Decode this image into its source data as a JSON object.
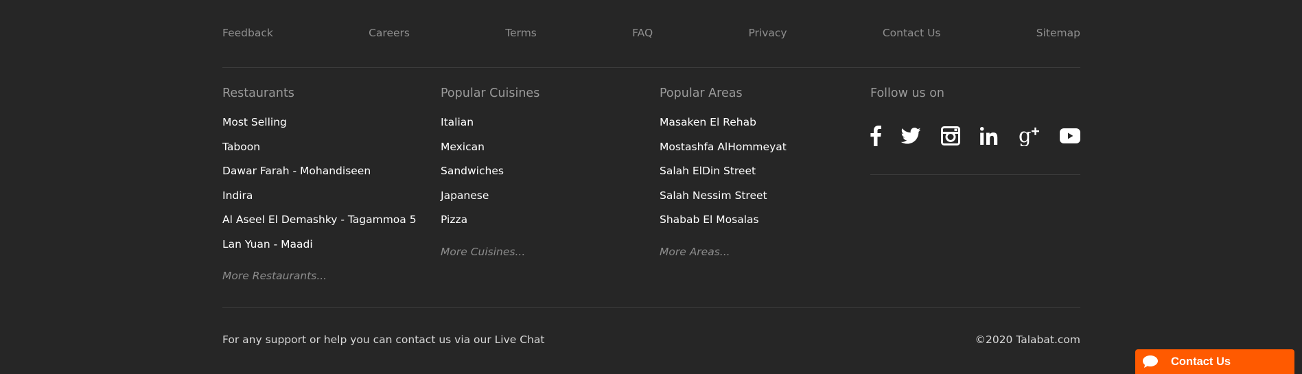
{
  "top_links": [
    "Feedback",
    "Careers",
    "Terms",
    "FAQ",
    "Privacy",
    "Contact Us",
    "Sitemap"
  ],
  "restaurants": {
    "heading": "Restaurants",
    "items": [
      "Most Selling",
      "Taboon",
      "Dawar Farah - Mohandiseen",
      "Indira",
      "Al Aseel El Demashky - Tagammoa 5",
      "Lan Yuan - Maadi"
    ],
    "more": "More Restaurants..."
  },
  "cuisines": {
    "heading": "Popular Cuisines",
    "items": [
      "Italian",
      "Mexican",
      "Sandwiches",
      "Japanese",
      "Pizza"
    ],
    "more": "More Cuisines..."
  },
  "areas": {
    "heading": "Popular Areas",
    "items": [
      "Masaken El Rehab",
      "Mostashfa AlHommeyat",
      "Salah ElDin Street",
      "Salah Nessim Street",
      "Shabab El Mosalas"
    ],
    "more": "More Areas..."
  },
  "follow": {
    "heading": "Follow us on",
    "icons": [
      "facebook-icon",
      "twitter-icon",
      "instagram-icon",
      "linkedin-icon",
      "google-plus-icon",
      "youtube-icon"
    ]
  },
  "footer": {
    "support": "For any support or help you can contact us via our Live Chat",
    "copyright": "©2020 Talabat.com"
  },
  "chat_button": {
    "label": "Contact Us",
    "color": "#ff5a00"
  }
}
